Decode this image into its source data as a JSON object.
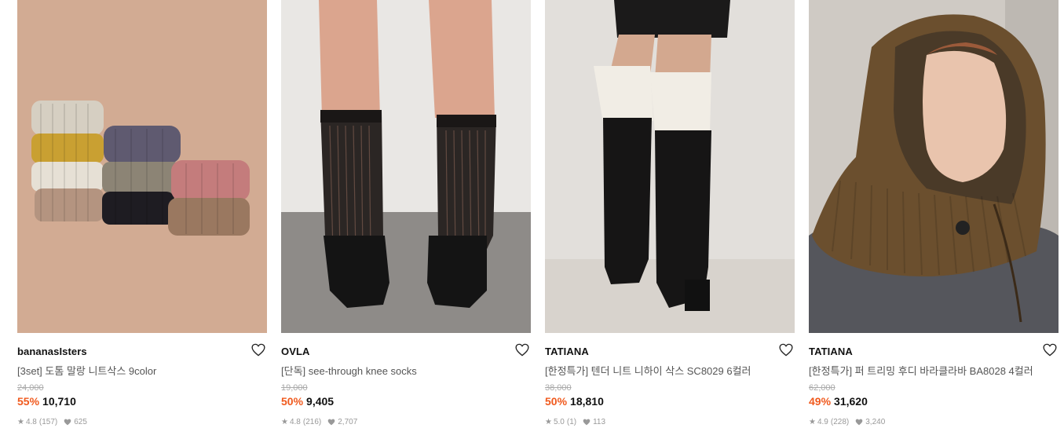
{
  "products": [
    {
      "brand": "bananasIsters",
      "title": "[3set] 도톰 말랑 니트삭스 9color",
      "original_price": "24,000",
      "discount": "55%",
      "price": "10,710",
      "rating": "4.8",
      "review_count": "(157)",
      "likes": "625"
    },
    {
      "brand": "OVLA",
      "title": "[단독] see-through knee socks",
      "original_price": "19,000",
      "discount": "50%",
      "price": "9,405",
      "rating": "4.8",
      "review_count": "(216)",
      "likes": "2,707"
    },
    {
      "brand": "TATIANA",
      "title": "[한정특가] 텐더 니트 니하이 삭스 SC8029 6컬러",
      "original_price": "38,000",
      "discount": "50%",
      "price": "18,810",
      "rating": "5.0",
      "review_count": "(1)",
      "likes": "113"
    },
    {
      "brand": "TATIANA",
      "title": "[한정특가] 퍼 트리밍 후디 바라클라바 BA8028 4컬러",
      "original_price": "62,000",
      "discount": "49%",
      "price": "31,620",
      "rating": "4.9",
      "review_count": "(228)",
      "likes": "3,240"
    }
  ],
  "colors": {
    "discount": "#f05a1e",
    "meta": "#999999",
    "strike": "#aaaaaa"
  },
  "icons": {
    "like": "heart-outline-icon",
    "rating": "star-icon",
    "likes": "heart-filled-icon"
  }
}
